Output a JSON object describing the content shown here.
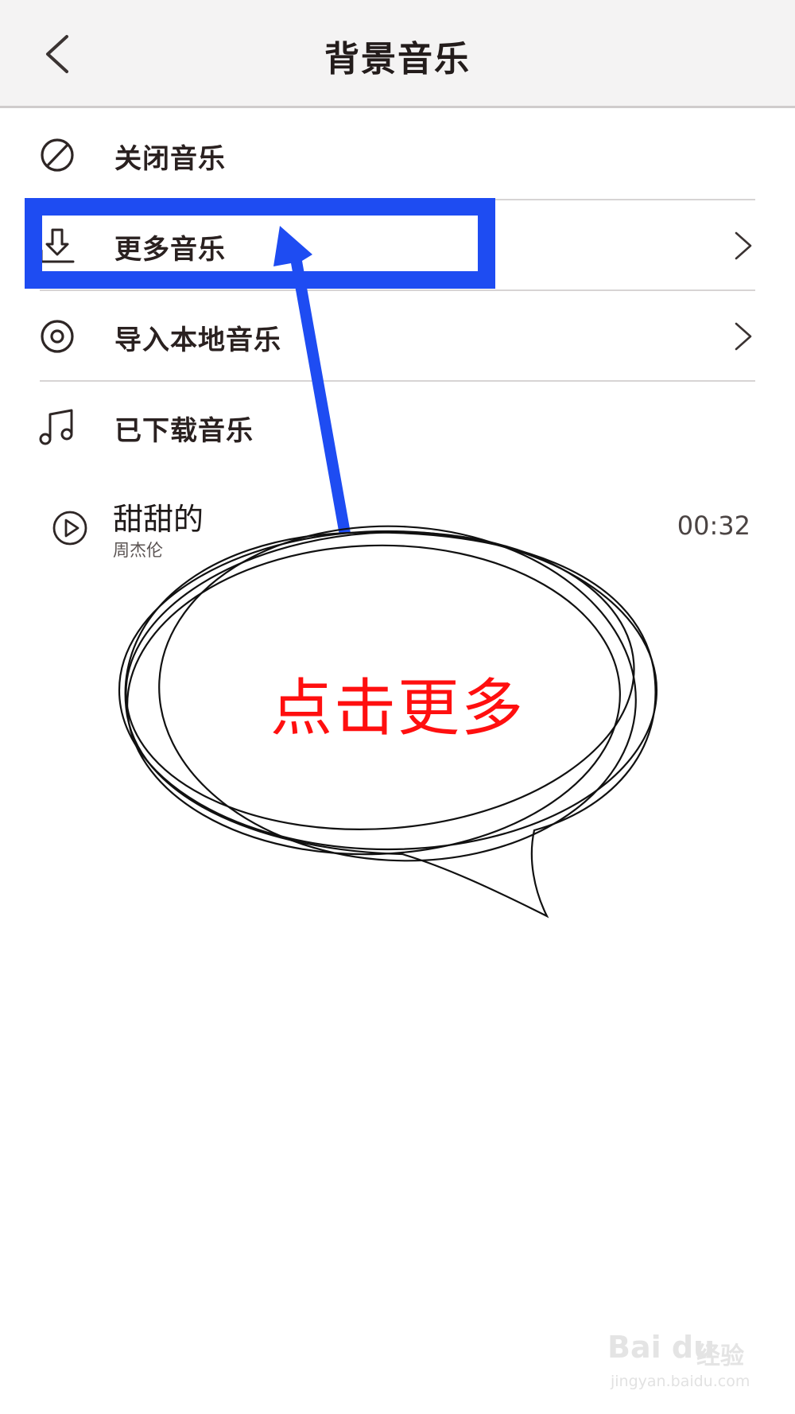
{
  "header": {
    "title": "背景音乐"
  },
  "menu": {
    "items": [
      {
        "label": "关闭音乐",
        "icon": "disable-icon"
      },
      {
        "label": "更多音乐",
        "icon": "download-icon"
      },
      {
        "label": "导入本地音乐",
        "icon": "disc-icon"
      },
      {
        "label": "已下载音乐",
        "icon": "music-note-icon"
      }
    ]
  },
  "downloaded": {
    "songs": [
      {
        "title": "甜甜的",
        "artist": "周杰伦",
        "duration": "00:32"
      }
    ]
  },
  "annotation": {
    "callout_text": "点击更多",
    "highlight_color": "#1e4cf2",
    "text_color": "#ff0f0f"
  },
  "watermark": {
    "logo": "Bai du",
    "brand": "经验",
    "url": "jingyan.baidu.com"
  }
}
